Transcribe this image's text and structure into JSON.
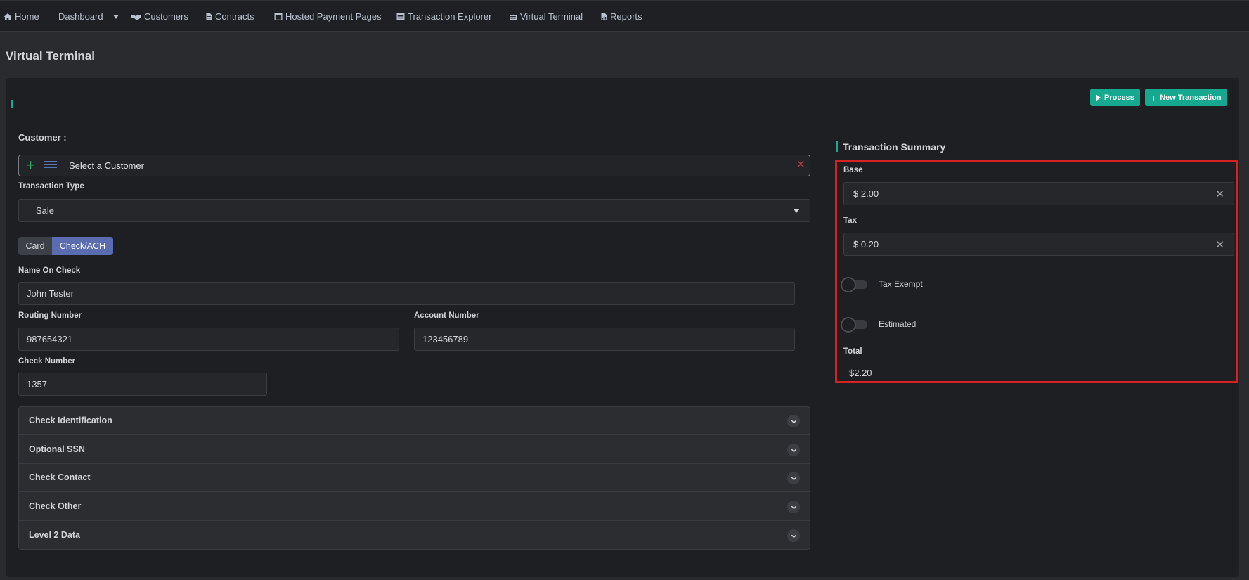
{
  "nav": {
    "items": [
      {
        "label": "Home",
        "icon": "home-icon"
      },
      {
        "label": "Dashboard",
        "icon": "caret-down-icon"
      },
      {
        "label": "Customers",
        "icon": "handshake-icon"
      },
      {
        "label": "Contracts",
        "icon": "document-icon"
      },
      {
        "label": "Hosted Payment Pages",
        "icon": "window-icon"
      },
      {
        "label": "Transaction Explorer",
        "icon": "table-icon"
      },
      {
        "label": "Virtual Terminal",
        "icon": "terminal-icon"
      },
      {
        "label": "Reports",
        "icon": "report-icon"
      }
    ]
  },
  "page": {
    "title": "Virtual Terminal"
  },
  "toolbar": {
    "process_label": "Process",
    "new_transaction_label": "New Transaction"
  },
  "form": {
    "customer_label": "Customer :",
    "customer_placeholder": "Select a Customer",
    "transaction_type_label": "Transaction Type",
    "transaction_type_value": "Sale",
    "payment_tabs": [
      "Card",
      "Check/ACH"
    ],
    "selected_tab": "Check/ACH",
    "name_on_check_label": "Name On Check",
    "name_on_check_value": "John Tester",
    "routing_number_label": "Routing Number",
    "routing_number_value": "987654321",
    "account_number_label": "Account Number",
    "account_number_value": "123456789",
    "check_number_label": "Check Number",
    "check_number_value": "1357"
  },
  "accordion": {
    "sections": [
      "Check Identification",
      "Optional SSN",
      "Check Contact",
      "Check Other",
      "Level 2 Data"
    ]
  },
  "summary": {
    "title": "Transaction Summary",
    "base_label": "Base",
    "base_value": "$ 2.00",
    "tax_label": "Tax",
    "tax_value": "$ 0.20",
    "tax_exempt_label": "Tax Exempt",
    "tax_exempt_on": false,
    "estimated_label": "Estimated",
    "estimated_on": false,
    "total_label": "Total",
    "total_value": "$2.20"
  },
  "colors": {
    "accent": "#17a98f",
    "selected_tab": "#5b6cb0",
    "highlight": "#d62222"
  }
}
